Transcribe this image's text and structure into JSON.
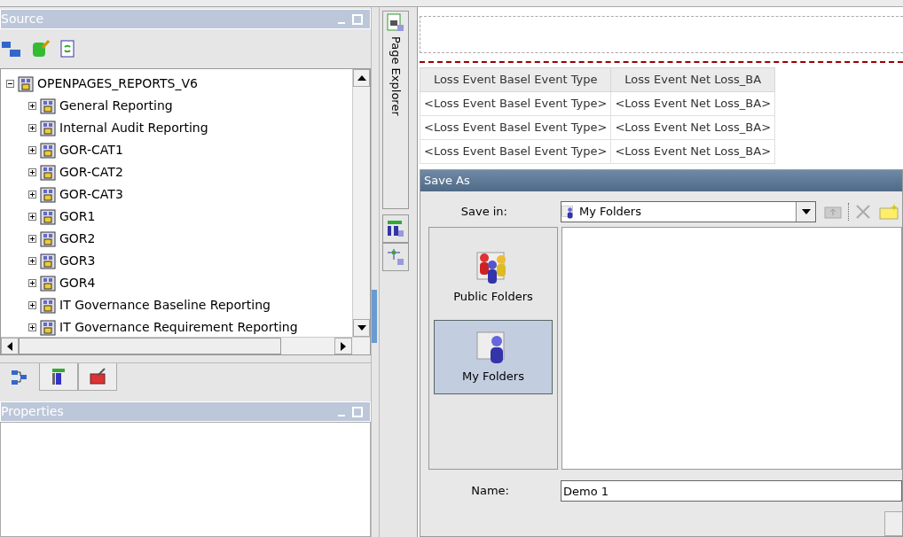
{
  "source_panel": {
    "title": "Source",
    "tree": [
      {
        "label": "OPENPAGES_REPORTS_V6",
        "expanded": true,
        "children": [
          {
            "label": "General Reporting",
            "expanded": false
          },
          {
            "label": "Internal Audit Reporting",
            "expanded": false
          },
          {
            "label": "GOR-CAT1",
            "expanded": false
          },
          {
            "label": "GOR-CAT2",
            "expanded": false
          },
          {
            "label": "GOR-CAT3",
            "expanded": false
          },
          {
            "label": "GOR1",
            "expanded": false
          },
          {
            "label": "GOR2",
            "expanded": false
          },
          {
            "label": "GOR3",
            "expanded": false
          },
          {
            "label": "GOR4",
            "expanded": false
          },
          {
            "label": "IT Governance Baseline Reporting",
            "expanded": false
          },
          {
            "label": "IT Governance Requirement Reporting",
            "expanded": false
          }
        ]
      }
    ],
    "bottom_tabs": [
      {
        "selected": true
      },
      {
        "selected": false
      },
      {
        "selected": false
      }
    ]
  },
  "properties_panel": {
    "title": "Properties"
  },
  "side_tab": {
    "label": "Page Explorer"
  },
  "report_table": {
    "columns": [
      "Loss Event Basel Event Type",
      "Loss Event Net Loss_BA"
    ],
    "rows": [
      [
        "<Loss Event Basel Event Type>",
        "<Loss Event Net Loss_BA>"
      ],
      [
        "<Loss Event Basel Event Type>",
        "<Loss Event Net Loss_BA>"
      ],
      [
        "<Loss Event Basel Event Type>",
        "<Loss Event Net Loss_BA>"
      ]
    ]
  },
  "save_dialog": {
    "title": "Save As",
    "save_in_label": "Save in:",
    "save_in_value": "My Folders",
    "places": [
      {
        "label": "Public Folders",
        "kind": "public",
        "selected": false
      },
      {
        "label": "My Folders",
        "kind": "mine",
        "selected": true
      }
    ],
    "name_label": "Name:",
    "name_value": "Demo 1"
  }
}
